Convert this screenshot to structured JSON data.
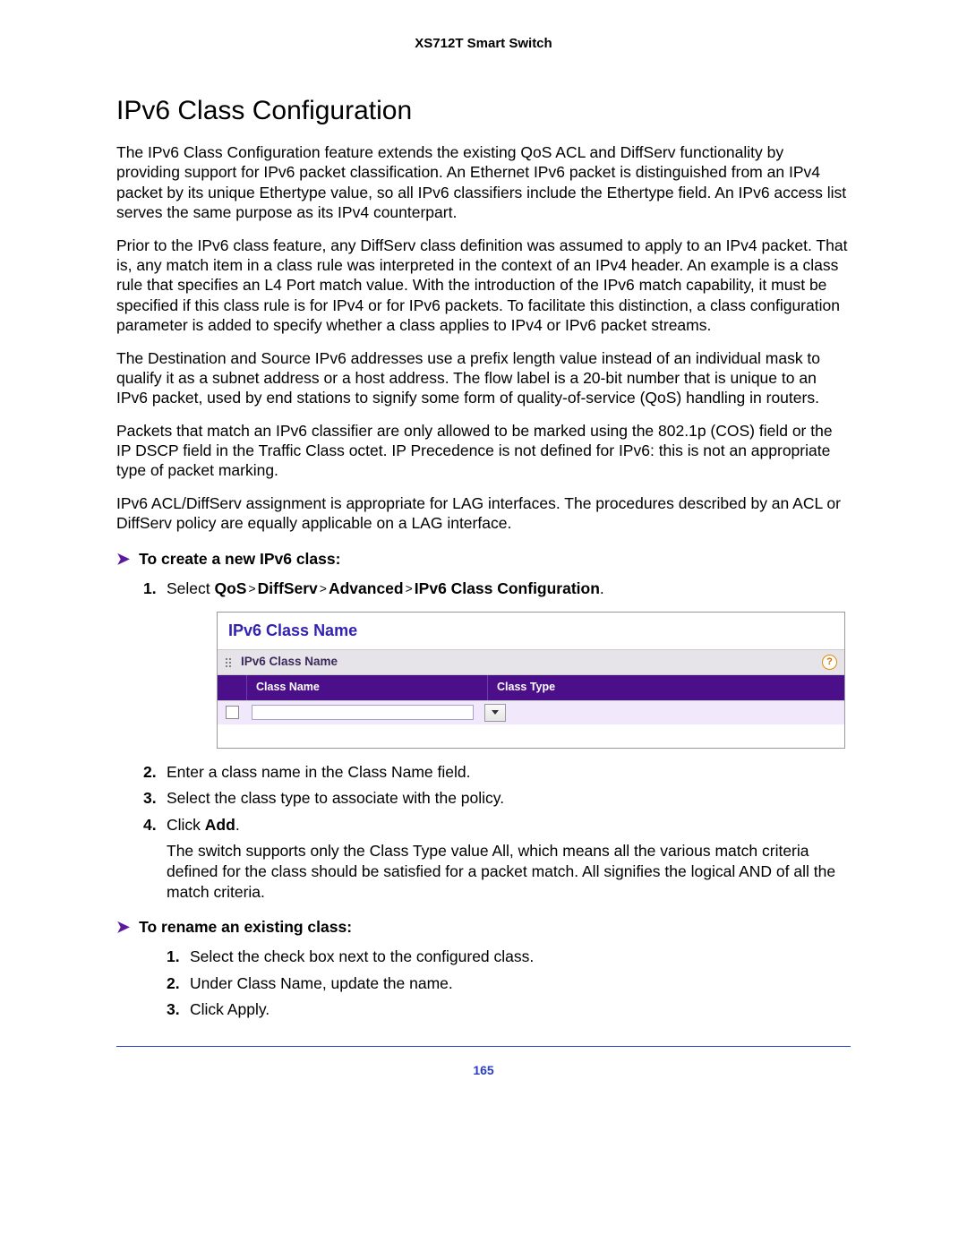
{
  "header": {
    "product": "XS712T Smart Switch"
  },
  "title": "IPv6 Class Configuration",
  "paragraphs": {
    "p1": "The IPv6 Class Configuration feature extends the existing QoS ACL and DiffServ functionality by providing support for IPv6 packet classification. An Ethernet IPv6 packet is distinguished from an IPv4 packet by its unique Ethertype value, so all IPv6 classifiers include the Ethertype field. An IPv6 access list serves the same purpose as its IPv4 counterpart.",
    "p2": "Prior to the IPv6 class feature, any DiffServ class definition was assumed to apply to an IPv4 packet. That is, any match item in a class rule was interpreted in the context of an IPv4 header. An example is a class rule that specifies an L4 Port match value. With the introduction of the IPv6 match capability, it must be specified if this class rule is for IPv4 or for IPv6 packets. To facilitate this distinction, a class configuration parameter is added to specify whether a class applies to IPv4 or IPv6 packet streams.",
    "p3": "The Destination and Source IPv6 addresses use a prefix length value instead of an individual mask to qualify it as a subnet address or a host address. The flow label is a 20-bit number that is unique to an IPv6 packet, used by end stations to signify some form of quality-of-service (QoS) handling in routers.",
    "p4": "Packets that match an IPv6 classifier are only allowed to be marked using the 802.1p (COS) field or the IP DSCP field in the Traffic Class octet. IP Precedence is not defined for IPv6: this is not an appropriate type of packet marking.",
    "p5": "IPv6 ACL/DiffServ assignment is appropriate for LAG interfaces. The procedures described by an ACL or DiffServ policy are equally applicable on a LAG interface."
  },
  "procedure_create": {
    "heading": "To create a new IPv6 class:",
    "step1_prefix": "Select ",
    "breadcrumb": [
      "QoS",
      "DiffServ",
      "Advanced",
      "IPv6 Class Configuration"
    ],
    "step1_suffix": ".",
    "step2": "Enter a class name in the Class Name field.",
    "step3": "Select the class type to associate with the policy.",
    "step4_prefix": "Click ",
    "step4_bold": "Add",
    "step4_suffix": ".",
    "step4_cont": "The switch supports only the Class Type value All, which means all the various match criteria defined for the class should be satisfied for a packet match. All signifies the logical AND of all the match criteria."
  },
  "widget": {
    "title": "IPv6 Class Name",
    "subtitle": "IPv6 Class Name",
    "columns": {
      "name": "Class Name",
      "type": "Class Type"
    }
  },
  "procedure_rename": {
    "heading": "To rename an existing class:",
    "s1": "Select the check box next to the configured class.",
    "s2": "Under Class Name, update the name.",
    "s3": "Click Apply."
  },
  "page_number": "165"
}
